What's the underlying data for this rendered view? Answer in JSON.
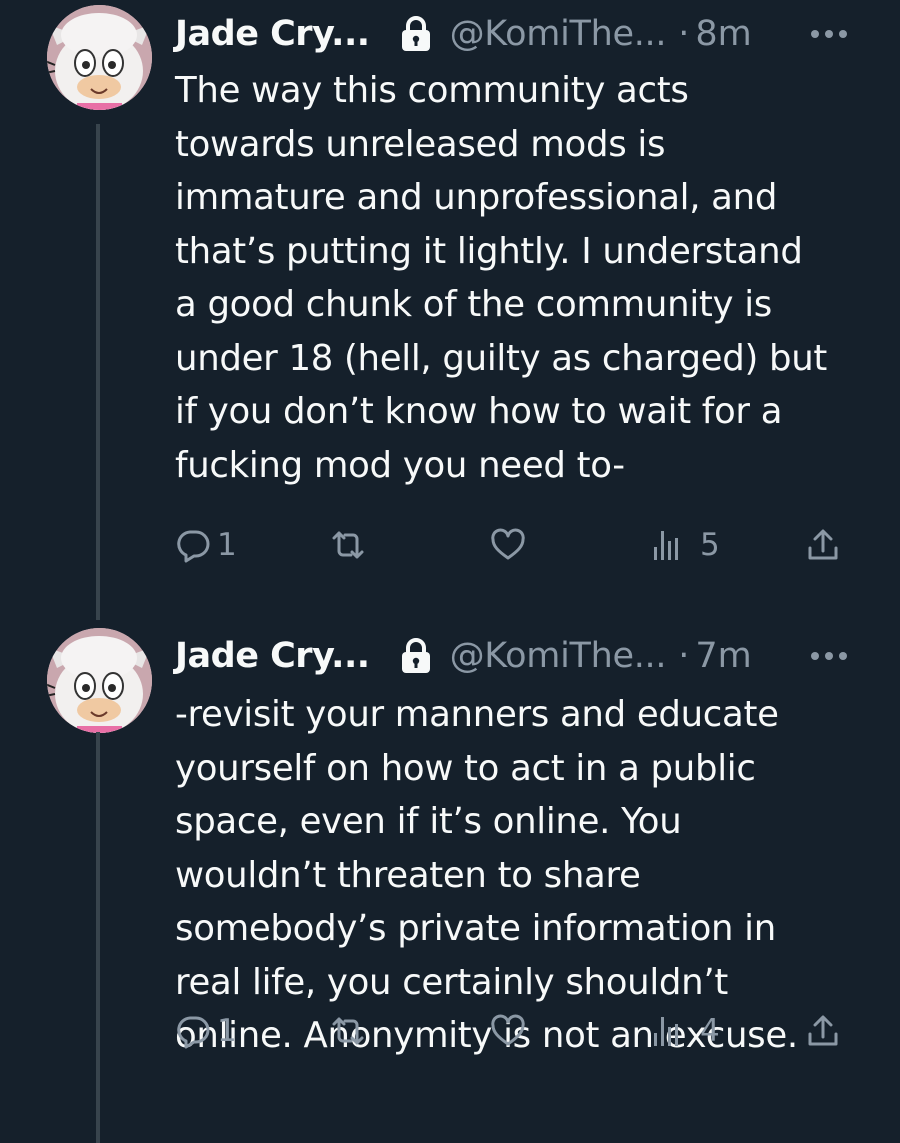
{
  "tweets": [
    {
      "display_name": "Jade Cry...",
      "handle": "@KomiThe...",
      "separator": "·",
      "time": "8m",
      "text": "The way this community acts\ntowards unreleased mods is\nimmature and unprofessional, and\nthat’s putting it lightly. I understand\na good chunk of the community is\nunder 18 (hell, guilty as charged) but\nif you don’t know how to wait for a\nfucking mod you need to-",
      "replies": "1",
      "retweets": "",
      "likes": "",
      "views": "5",
      "icons": {
        "lock": "lock-icon",
        "more": "more-icon",
        "reply": "reply-icon",
        "retweet": "retweet-icon",
        "like": "heart-icon",
        "views": "views-icon",
        "share": "share-icon"
      }
    },
    {
      "display_name": "Jade Cry...",
      "handle": "@KomiThe...",
      "separator": "·",
      "time": "7m",
      "text": "-revisit your manners and educate\nyourself on how to act in a public\nspace, even if it’s online. You\nwouldn’t threaten to share\nsomebody’s private information in\nreal life, you certainly shouldn’t\nonline. Anonymity is not an excuse.",
      "replies": "1",
      "retweets": "",
      "likes": "",
      "views": "4",
      "icons": {
        "lock": "lock-icon",
        "more": "more-icon",
        "reply": "reply-icon",
        "retweet": "retweet-icon",
        "like": "heart-icon",
        "views": "views-icon",
        "share": "share-icon"
      }
    }
  ],
  "colors": {
    "background": "#15202b",
    "primary_text": "#f7f9f9",
    "secondary_text": "#8b98a5",
    "thread_line": "#38444d"
  }
}
